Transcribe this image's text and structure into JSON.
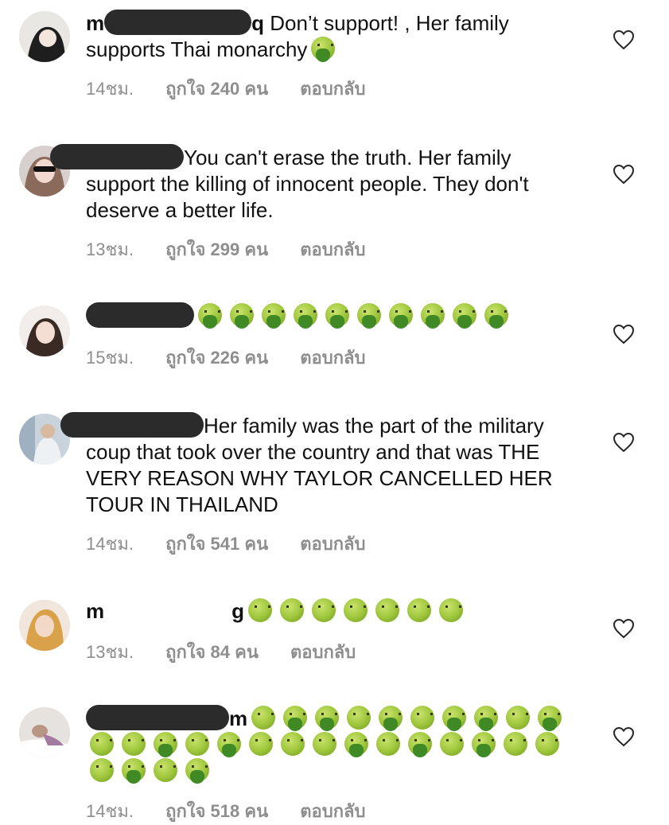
{
  "comments": [
    {
      "username_visible_start": "m",
      "username_visible_end": "q",
      "text": " Don’t support! , Her family supports Thai monarchy",
      "emojis": [
        "vomit"
      ],
      "time": "14ชม.",
      "likes": "ถูกใจ 240 คน",
      "reply": "ตอบกลับ"
    },
    {
      "username_visible_start": "",
      "username_visible_end": "",
      "text": "You can't erase the truth. Her family support the killing of innocent people. They don't deserve a better life.",
      "emojis": [],
      "time": "13ชม.",
      "likes": "ถูกใจ 299 คน",
      "reply": "ตอบกลับ"
    },
    {
      "username_visible_start": "",
      "username_visible_end": "",
      "text": "",
      "emojis": [
        "vomit",
        "vomit",
        "vomit",
        "vomit",
        "vomit",
        "vomit",
        "vomit",
        "vomit",
        "vomit",
        "vomit"
      ],
      "time": "15ชม.",
      "likes": "ถูกใจ 226 คน",
      "reply": "ตอบกลับ"
    },
    {
      "username_visible_start": "",
      "username_visible_end": "",
      "text": "Her family was the part of the military coup that took over the country and that was THE VERY REASON WHY TAYLOR CANCELLED HER TOUR IN THAILAND",
      "emojis": [],
      "time": "14ชม.",
      "likes": "ถูกใจ 541 คน",
      "reply": "ตอบกลับ"
    },
    {
      "username_visible_start": "m",
      "username_visible_end": "g",
      "text": "",
      "emojis": [
        "nauseated",
        "nauseated",
        "nauseated",
        "nauseated",
        "nauseated",
        "nauseated",
        "nauseated"
      ],
      "time": "13ชม.",
      "likes": "ถูกใจ 84 คน",
      "reply": "ตอบกลับ"
    },
    {
      "username_visible_start": "",
      "username_visible_end": "m",
      "text": "",
      "emojis": [
        "nauseated",
        "vomit",
        "vomit",
        "nauseated",
        "vomit",
        "nauseated",
        "vomit",
        "vomit",
        "nauseated",
        "vomit",
        "nauseated",
        "nauseated",
        "vomit",
        "nauseated",
        "vomit",
        "nauseated",
        "nauseated",
        "nauseated",
        "vomit",
        "nauseated",
        "vomit",
        "nauseated",
        "vomit",
        "nauseated",
        "nauseated",
        "nauseated",
        "vomit",
        "nauseated",
        "vomit"
      ],
      "time": "14ชม.",
      "likes": "ถูกใจ 518 คน",
      "reply": "ตอบกลับ"
    }
  ],
  "icons": {
    "like": "heart-outline-icon",
    "emoji_vomit": "face-vomiting-icon",
    "emoji_nauseated": "nauseated-face-icon"
  },
  "colors": {
    "text": "#111111",
    "meta": "#8e8e8e",
    "redaction": "#2b2b2b",
    "heart_stroke": "#262626"
  }
}
